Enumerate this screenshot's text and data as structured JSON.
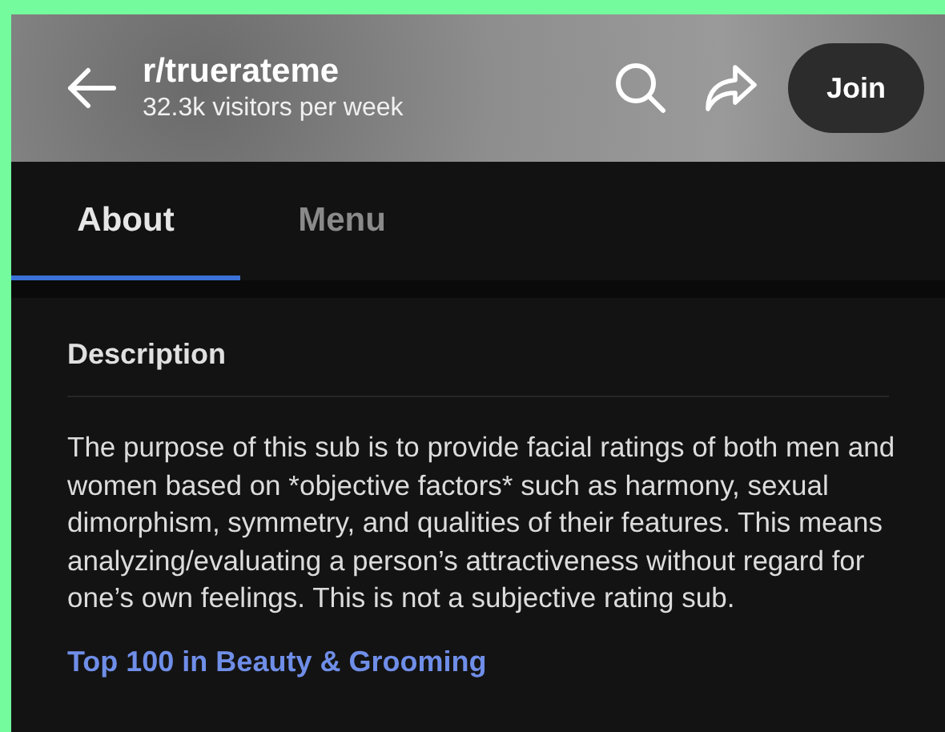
{
  "header": {
    "title": "r/truerateme",
    "subtitle": "32.3k visitors per week",
    "join_label": "Join"
  },
  "tabs": [
    {
      "label": "About",
      "selected": true
    },
    {
      "label": "Menu",
      "selected": false
    }
  ],
  "section": {
    "heading": "Description",
    "body": "The purpose of this sub is to provide facial ratings of both men and women based on *objective factors* such as harmony, sexual dimorphism, symmetry, and qualities of their features. This means analyzing/evaluating a person’s attractiveness without regard for one’s own feelings. This is not a subjective rating sub.",
    "link": "Top 100 in Beauty & Grooming"
  }
}
